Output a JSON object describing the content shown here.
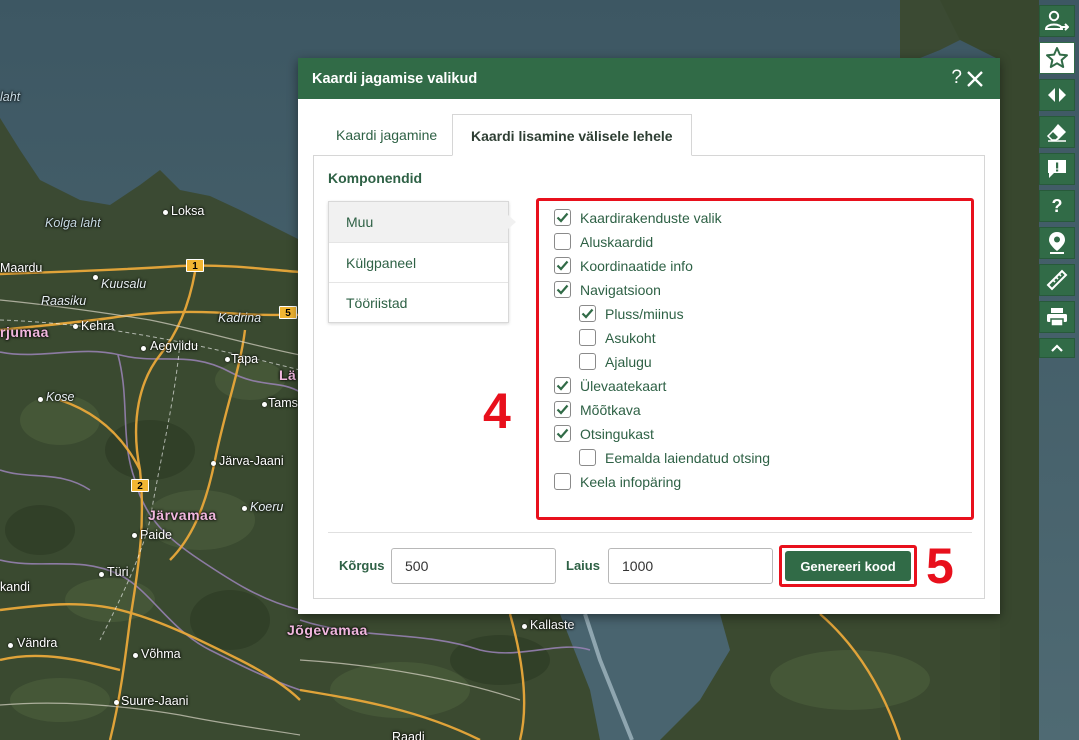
{
  "map": {
    "water_labels": [
      "laht",
      "Kolga laht"
    ],
    "places": [
      "Loksa",
      "Maardu",
      "Kuusalu",
      "Raasiku",
      "Kehra",
      "Aegviidu",
      "Kadrina",
      "Tapa",
      "Kose",
      "Tams",
      "Järva-Jaani",
      "Koeru",
      "Paide",
      "Türi",
      "kandi",
      "Vändra",
      "Võhma",
      "Suure-Jaani",
      "Kallaste",
      "Raadi"
    ],
    "regions": [
      "rjumaa",
      "Lä",
      "Järvamaa",
      "Jõgevamaa"
    ],
    "road_shields": [
      "1",
      "5",
      "2"
    ]
  },
  "toolbar": {
    "icons": [
      "user-share-icon",
      "star-icon",
      "compare-arrows-icon",
      "eraser-icon",
      "feedback-icon",
      "help-icon",
      "location-pin-icon",
      "ruler-icon",
      "print-icon",
      "chevron-up-icon"
    ],
    "help_label": "?"
  },
  "dialog": {
    "title": "Kaardi jagamise valikud",
    "help_label": "?",
    "tabs": [
      {
        "label": "Kaardi jagamine",
        "active": false
      },
      {
        "label": "Kaardi lisamine välisele lehele",
        "active": true
      }
    ],
    "components_title": "Komponendid",
    "components": [
      {
        "label": "Muu",
        "active": true
      },
      {
        "label": "Külgpaneel",
        "active": false
      },
      {
        "label": "Tööriistad",
        "active": false
      }
    ],
    "options": [
      {
        "label": "Kaardirakenduste valik",
        "checked": true,
        "indent": false
      },
      {
        "label": "Aluskaardid",
        "checked": false,
        "indent": false
      },
      {
        "label": "Koordinaatide info",
        "checked": true,
        "indent": false
      },
      {
        "label": "Navigatsioon",
        "checked": true,
        "indent": false
      },
      {
        "label": "Pluss/miinus",
        "checked": true,
        "indent": true
      },
      {
        "label": "Asukoht",
        "checked": false,
        "indent": true
      },
      {
        "label": "Ajalugu",
        "checked": false,
        "indent": true
      },
      {
        "label": "Ülevaatekaart",
        "checked": true,
        "indent": false
      },
      {
        "label": "Mõõtkava",
        "checked": true,
        "indent": false
      },
      {
        "label": "Otsingukast",
        "checked": true,
        "indent": false
      },
      {
        "label": "Eemalda laiendatud otsing",
        "checked": false,
        "indent": true
      },
      {
        "label": "Keela infopäring",
        "checked": false,
        "indent": false
      }
    ],
    "annotation_4": "4",
    "height_label": "Kõrgus",
    "height_value": "500",
    "width_label": "Laius",
    "width_value": "1000",
    "generate_label": "Genereeri kood",
    "annotation_5": "5"
  },
  "colors": {
    "accent": "#316b47",
    "highlight": "#e8101c",
    "text_green": "#2e6145"
  }
}
